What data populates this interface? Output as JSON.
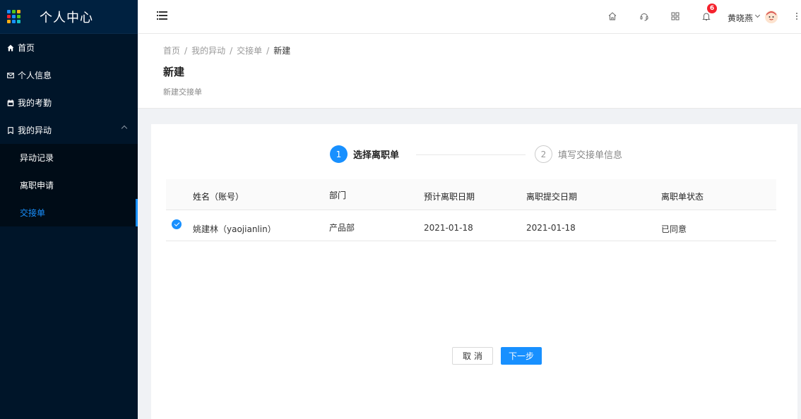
{
  "sidebar": {
    "app_title": "个人中心",
    "menu": [
      {
        "label": "首页",
        "icon": "home-icon"
      },
      {
        "label": "个人信息",
        "icon": "mail-icon"
      },
      {
        "label": "我的考勤",
        "icon": "calendar-icon"
      },
      {
        "label": "我的异动",
        "icon": "bookmark-icon",
        "expanded": true
      }
    ],
    "submenu": [
      {
        "label": "异动记录"
      },
      {
        "label": "离职申请"
      },
      {
        "label": "交接单",
        "active": true
      }
    ],
    "logo_colors": [
      "#1890ff",
      "#52c41a",
      "#faad14",
      "#f5222d",
      "#1890ff",
      "#52c41a",
      "#faad14",
      "#1890ff",
      "#13c2c2"
    ]
  },
  "header": {
    "icons": [
      "home-icon",
      "headset-icon",
      "apps-grid-icon",
      "bell-icon"
    ],
    "notification_count": "6",
    "username": "黄晓燕"
  },
  "page_header": {
    "breadcrumb": [
      "首页",
      "我的异动",
      "交接单",
      "新建"
    ],
    "title": "新建",
    "description": "新建交接单"
  },
  "steps": [
    {
      "number": "1",
      "label": "选择离职单",
      "status": "current"
    },
    {
      "number": "2",
      "label": "填写交接单信息",
      "status": "waiting"
    }
  ],
  "table": {
    "columns": [
      "姓名（账号）",
      "部门",
      "预计离职日期",
      "离职提交日期",
      "离职单状态"
    ],
    "rows": [
      {
        "selected": true,
        "name": "姚建林（yaojianlin）",
        "department": "产品部",
        "expected_date": "2021-01-18",
        "submit_date": "2021-01-18",
        "status": "已同意"
      }
    ]
  },
  "actions": {
    "cancel_label": "取消",
    "next_label": "下一步"
  },
  "colors": {
    "primary": "#1890ff",
    "sidebar_bg": "#001529",
    "badge": "#f5222d"
  }
}
